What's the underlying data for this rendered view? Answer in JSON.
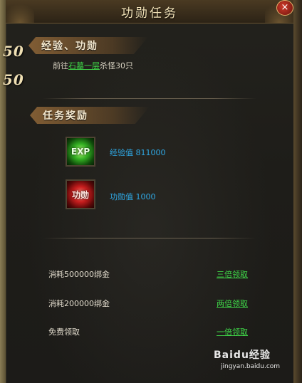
{
  "window": {
    "title": "功勋任务",
    "close_symbol": "×"
  },
  "left_counters": [
    "50",
    "50"
  ],
  "section_exp": {
    "heading": "经验、功勋"
  },
  "task": {
    "prefix": "前往",
    "location_link": "石墓一层",
    "suffix": "杀怪30只"
  },
  "section_rewards": {
    "heading": "任务奖励"
  },
  "rewards": [
    {
      "icon_text": "EXP",
      "icon": "exp-icon",
      "label": "经验值",
      "value": "811000"
    },
    {
      "icon_text": "功勋",
      "icon": "merit-icon",
      "label": "功勋值",
      "value": "1000"
    }
  ],
  "claim_options": [
    {
      "label": "消耗500000绑金",
      "action": "三倍领取"
    },
    {
      "label": "消耗200000绑金",
      "action": "两倍领取"
    },
    {
      "label": "免费领取",
      "action": "一倍领取"
    }
  ],
  "watermark": {
    "brand": "Baidu经验",
    "url": "jingyan.baidu.com"
  }
}
